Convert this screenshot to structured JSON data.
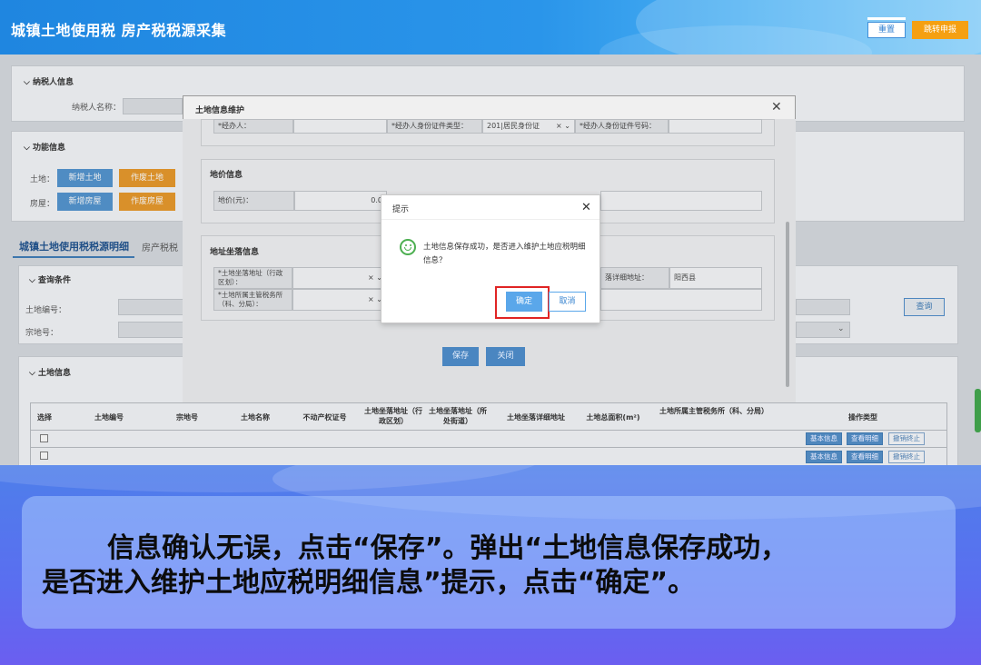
{
  "header": {
    "title": "城镇土地使用税 房产税税源采集",
    "reset_label": "重置",
    "jump_label": "跳转申报"
  },
  "taxpayer": {
    "section": "纳税人信息",
    "name_label": "纳税人名称："
  },
  "functions": {
    "section": "功能信息",
    "land_label": "土地：",
    "house_label": "房屋：",
    "add_land": "新增土地",
    "void_land": "作废土地",
    "add_house": "新增房屋",
    "void_house": "作废房屋"
  },
  "tabs": {
    "land_detail": "城镇土地使用税税源明细",
    "house_detail": "房产税税"
  },
  "query": {
    "section": "查询条件",
    "land_no": "土地编号：",
    "parcel_no": "宗地号：",
    "query_btn": "查询"
  },
  "land_info": {
    "section": "土地信息",
    "headers": [
      "选择",
      "土地编号",
      "宗地号",
      "土地名称",
      "不动产权证号",
      "土地坐落地址（行政区划）",
      "土地坐落地址（所处街道）",
      "土地坐落详细地址",
      "土地总面积(m²)",
      "土地所属主管税务所（科、分局）",
      "操作类型"
    ],
    "ops": [
      "基本信息",
      "查看明细",
      "撤销终止"
    ]
  },
  "land_dialog": {
    "title": "土地信息维护",
    "agent_label": "*经办人：",
    "agent_id_type_label": "*经办人身份证件类型：",
    "agent_id_type_value": "201|居民身份证",
    "agent_id_no_label": "*经办人身份证件号码：",
    "price_section": "地价信息",
    "price_label": "地价(元)：",
    "price_value": "0.0",
    "addr_section": "地址坐落信息",
    "addr_admin_label": "*土地坐落地址（行政区划）：",
    "addr_office_label": "*土地所属主管税务所（科、分局）：",
    "addr_detail_label": "落详细地址：",
    "addr_detail_value": "阳西县",
    "save_label": "保存",
    "close_label": "关闭"
  },
  "tip_dialog": {
    "title": "提示",
    "message": "土地信息保存成功，是否进入维护土地应税明细信息？",
    "ok_label": "确定",
    "cancel_label": "取消"
  },
  "caption": {
    "line1": "信息确认无误，点击“保存”。弹出“土地信息保存成功，",
    "line2": "是否进入维护土地应税明细信息”提示，点击“确定”。"
  }
}
